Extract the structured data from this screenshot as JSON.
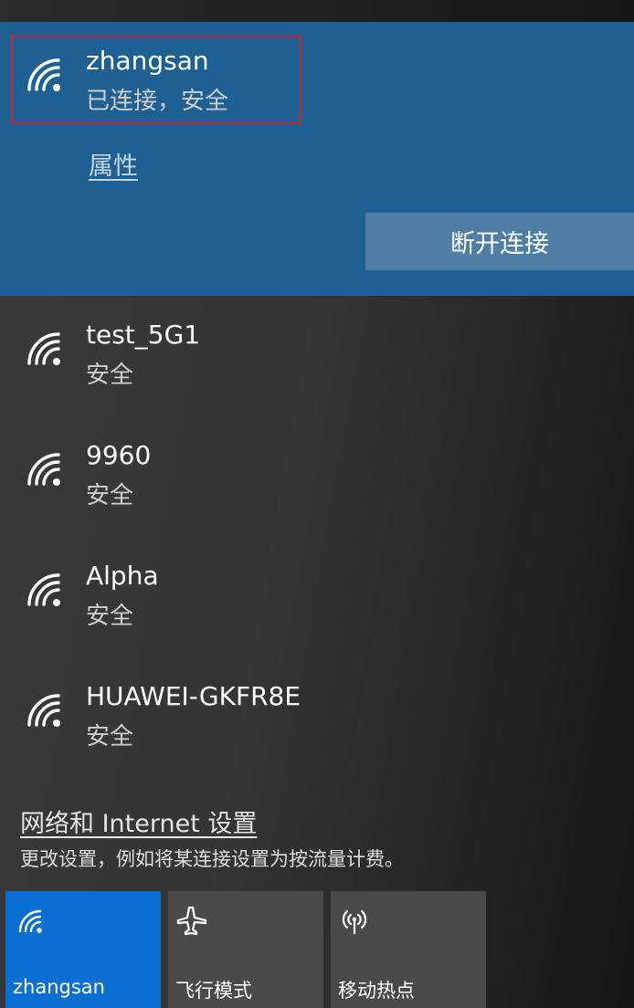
{
  "connected": {
    "ssid": "zhangsan",
    "status": "已连接，安全",
    "properties_label": "属性",
    "disconnect_label": "断开连接",
    "icon": "wifi-icon"
  },
  "networks": [
    {
      "ssid": "test_5G1",
      "status": "安全",
      "icon": "wifi-icon"
    },
    {
      "ssid": "9960",
      "status": "安全",
      "icon": "wifi-icon"
    },
    {
      "ssid": "Alpha",
      "status": "安全",
      "icon": "wifi-icon"
    },
    {
      "ssid": "HUAWEI-GKFR8E",
      "status": "安全",
      "icon": "wifi-icon"
    }
  ],
  "settings": {
    "link": "网络和 Internet 设置",
    "description": "更改设置，例如将某连接设置为按流量计费。"
  },
  "quick_actions": [
    {
      "label": "zhangsan",
      "icon": "wifi-icon",
      "active": true
    },
    {
      "label": "飞行模式",
      "icon": "airplane-icon",
      "active": false
    },
    {
      "label": "移动热点",
      "icon": "hotspot-icon",
      "active": false
    }
  ],
  "colors": {
    "connected_background": "#1e5f94",
    "disconnect_button": "#4e7ea6",
    "selection_border": "#c4253a",
    "active_tile": "#0a6fd0",
    "tile": "#4a4a4a"
  }
}
